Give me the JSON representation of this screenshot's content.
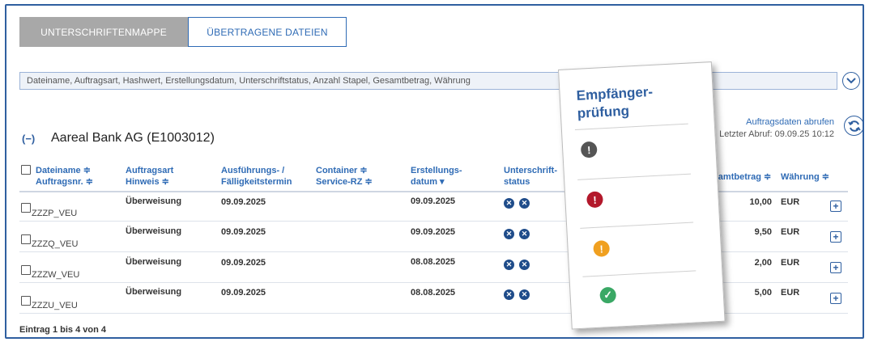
{
  "tabs": [
    {
      "label": "UNTERSCHRIFTENMAPPE",
      "active": true
    },
    {
      "label": "ÜBERTRAGENE DATEIEN",
      "active": false
    }
  ],
  "search": {
    "placeholder": "Dateiname, Auftragsart, Hashwert, Erstellungsdatum, Unterschriftstatus, Anzahl Stapel, Gesamtbetrag, Währung"
  },
  "group": {
    "collapse_icon": "(−)",
    "title": "Aareal Bank AG (E1003012)",
    "fetch_link": "Auftragsdaten abrufen",
    "last_fetch": "Letzter Abruf: 09.09.25 10:12"
  },
  "columns": {
    "dateiname": "Dateiname ≑",
    "auftragsnr": "Auftragsnr. ≑",
    "auftragsart": "Auftragsart",
    "hinweis": "Hinweis ≑",
    "ausfuehrung1": "Ausführungs- /",
    "ausfuehrung2": "Fälligkeitstermin",
    "container": "Container ≑",
    "service": "Service-RZ ≑",
    "erstellung1": "Erstellungs-",
    "erstellung2": "datum ▾",
    "unterschrift1": "Unterschrift-",
    "unterschrift2": "status",
    "gesamtbetrag": "Gesamtbetrag ≑",
    "waehrung": "Währung ≑"
  },
  "rows": [
    {
      "name": "ZZZP_VEU",
      "type": "Überweisung",
      "exec": "09.09.2025",
      "created": "09.09.2025",
      "amount": "10,00",
      "currency": "EUR"
    },
    {
      "name": "ZZZQ_VEU",
      "type": "Überweisung",
      "exec": "09.09.2025",
      "created": "09.09.2025",
      "amount": "9,50",
      "currency": "EUR"
    },
    {
      "name": "ZZZW_VEU",
      "type": "Überweisung",
      "exec": "09.09.2025",
      "created": "08.08.2025",
      "amount": "2,00",
      "currency": "EUR"
    },
    {
      "name": "ZZZU_VEU",
      "type": "Überweisung",
      "exec": "09.09.2025",
      "created": "08.08.2025",
      "amount": "5,00",
      "currency": "EUR"
    }
  ],
  "footer": "Eintrag 1 bis 4 von 4",
  "card": {
    "title_line1": "Empfänger-",
    "title_line2": "prüfung",
    "statuses": [
      {
        "icon": "exclamation-gray-icon",
        "color": "#555555",
        "glyph": "!"
      },
      {
        "icon": "exclamation-red-icon",
        "color": "#b3182b",
        "glyph": "!"
      },
      {
        "icon": "exclamation-orange-icon",
        "color": "#f0a020",
        "glyph": "!"
      },
      {
        "icon": "check-green-icon",
        "color": "#3aa865",
        "glyph": "✓"
      }
    ]
  },
  "icons": {
    "x_glyph": "✕",
    "plus_glyph": "+",
    "chevron_glyph": "⌄",
    "refresh_glyph": "⟳"
  }
}
